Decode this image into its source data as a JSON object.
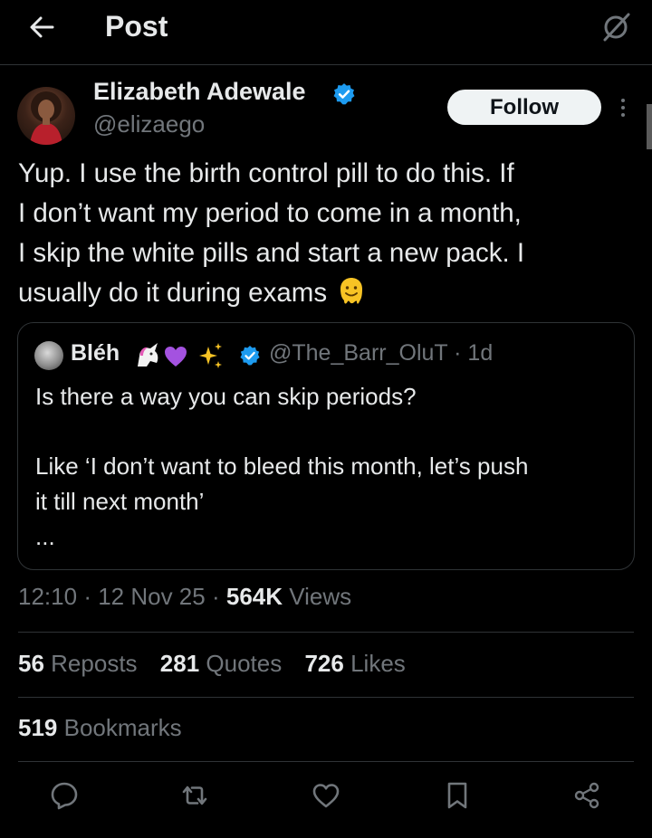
{
  "header": {
    "title": "Post",
    "back_icon": "arrow-left-icon",
    "grok_icon": "grok-icon"
  },
  "post": {
    "author": {
      "name": "Elizabeth Adewale",
      "handle": "@elizaego",
      "verified": true
    },
    "follow_label": "Follow",
    "text_lines": [
      "Yup. I use the birth control pill to do this. If",
      "I don’t want my period to come in a month,",
      "I skip the white pills and start a new pack. I",
      "usually do it during exams"
    ],
    "text_emoji": "melting-face-emoji",
    "quote": {
      "name": "Bléh",
      "emojis": [
        "unicorn-emoji",
        "purple-heart-emoji",
        "sparkles-emoji"
      ],
      "handle_time": "@The_Barr_OluT · 1d",
      "lines": [
        "Is there a way you can skip periods?",
        "Like ‘I don’t want to bleed this month, let’s push",
        "it till next month’",
        "..."
      ]
    },
    "meta": {
      "time": "12:10",
      "date": "12 Nov 25",
      "views_count": "564K",
      "views_label": "Views"
    },
    "stats": {
      "reposts_count": "56",
      "reposts_label": "Reposts",
      "quotes_count": "281",
      "quotes_label": "Quotes",
      "likes_count": "726",
      "likes_label": "Likes",
      "bookmarks_count": "519",
      "bookmarks_label": "Bookmarks"
    }
  },
  "actions": [
    "reply-icon",
    "repost-icon",
    "like-icon",
    "bookmark-icon",
    "share-icon"
  ],
  "colors": {
    "background": "#000000",
    "text": "#e7e9ea",
    "secondary": "#71767b",
    "border": "#2f3336",
    "verified": "#1d9bf0"
  }
}
